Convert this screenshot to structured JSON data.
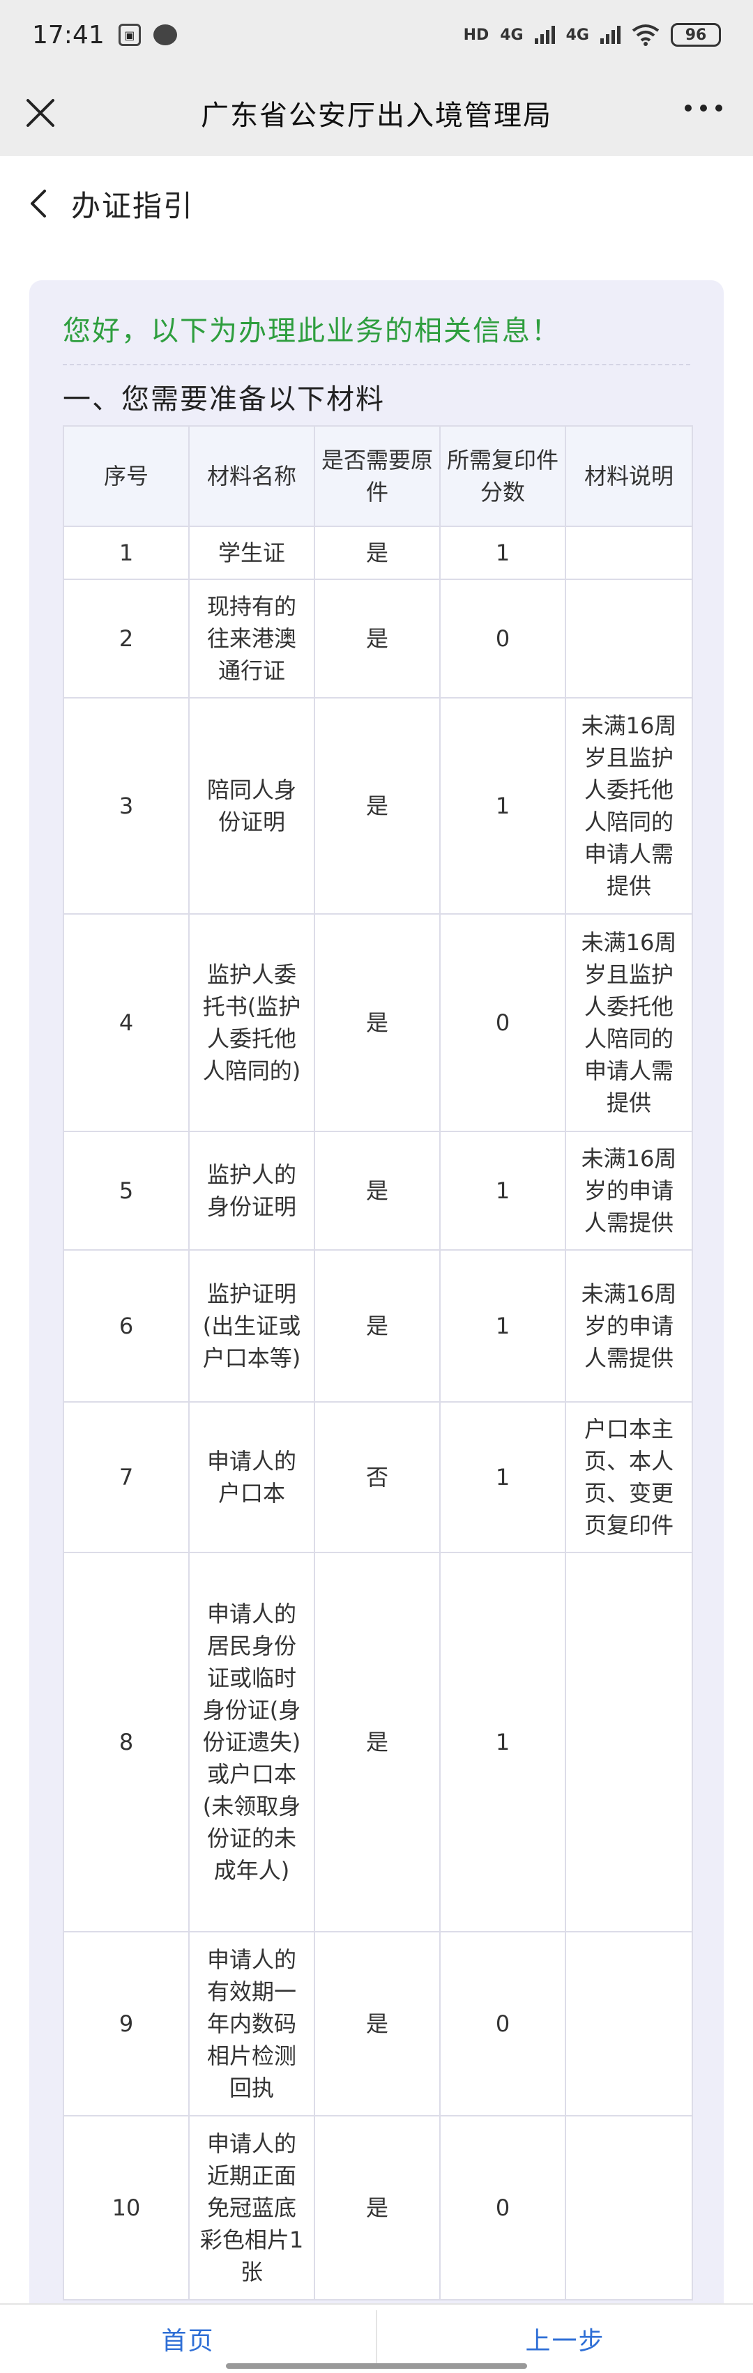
{
  "status_bar": {
    "time": "17:41",
    "hd_label": "HD",
    "net1": "4G",
    "net2": "4G",
    "battery": "96"
  },
  "title_bar": {
    "title": "广东省公安厅出入境管理局"
  },
  "sub_header": {
    "title": "办证指引"
  },
  "main": {
    "greeting": "您好，以下为办理此业务的相关信息！",
    "section_title": "一、您需要准备以下材料",
    "table": {
      "headers": [
        "序号",
        "材料名称",
        "是否需要原件",
        "所需复印件分数",
        "材料说明"
      ],
      "rows": [
        {
          "no": "1",
          "name": "学生证",
          "original": "是",
          "copies": "1",
          "note": ""
        },
        {
          "no": "2",
          "name": "现持有的往来港澳通行证",
          "original": "是",
          "copies": "0",
          "note": ""
        },
        {
          "no": "3",
          "name": "陪同人身份证明",
          "original": "是",
          "copies": "1",
          "note": "未满16周岁且监护人委托他人陪同的申请人需提供"
        },
        {
          "no": "4",
          "name": "监护人委托书(监护人委托他人陪同的)",
          "original": "是",
          "copies": "0",
          "note": "未满16周岁且监护人委托他人陪同的申请人需提供"
        },
        {
          "no": "5",
          "name": "监护人的身份证明",
          "original": "是",
          "copies": "1",
          "note": "未满16周岁的申请人需提供"
        },
        {
          "no": "6",
          "name": "监护证明(出生证或户口本等)",
          "original": "是",
          "copies": "1",
          "note": "未满16周岁的申请人需提供"
        },
        {
          "no": "7",
          "name": "申请人的户口本",
          "original": "否",
          "copies": "1",
          "note": "户口本主页、本人页、变更页复印件"
        },
        {
          "no": "8",
          "name": "申请人的居民身份证或临时身份证(身份证遗失)或户口本(未领取身份证的未成年人)",
          "original": "是",
          "copies": "1",
          "note": ""
        },
        {
          "no": "9",
          "name": "申请人的有效期一年内数码相片检测回执",
          "original": "是",
          "copies": "0",
          "note": ""
        },
        {
          "no": "10",
          "name": "申请人的近期正面免冠蓝底彩色相片1张",
          "original": "是",
          "copies": "0",
          "note": ""
        }
      ]
    }
  },
  "bottom_bar": {
    "home_label": "首页",
    "back_label": "上一步"
  }
}
